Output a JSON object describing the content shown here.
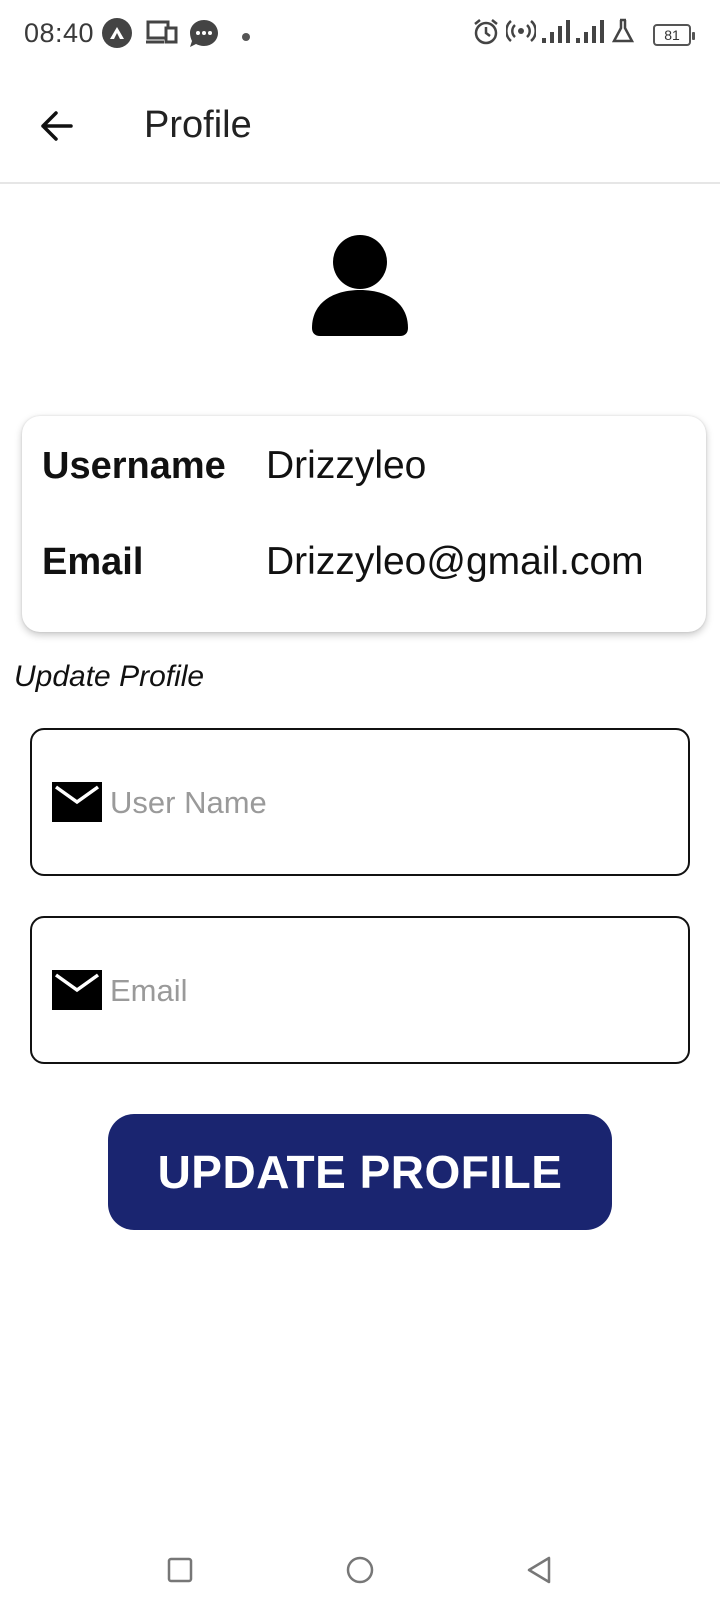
{
  "status_bar": {
    "time": "08:40",
    "battery": "81",
    "icons": [
      "navigation-app-icon",
      "devices-icon",
      "chat-bubble-icon",
      "dot-icon",
      "alarm-icon",
      "hotspot-icon",
      "signal-icon",
      "signal-icon",
      "lab-flask-icon",
      "battery-icon"
    ]
  },
  "app_bar": {
    "title": "Profile",
    "back_icon": "arrow-left-icon"
  },
  "avatar": {
    "icon": "person-icon"
  },
  "info_card": {
    "username_label": "Username",
    "username_value": "Drizzyleo",
    "email_label": "Email",
    "email_value": "Drizzyleo@gmail.com"
  },
  "update_section": {
    "title": "Update Profile",
    "username_input": {
      "placeholder": "User Name",
      "value": "",
      "icon": "mail-icon"
    },
    "email_input": {
      "placeholder": "Email",
      "value": "",
      "icon": "mail-icon"
    },
    "submit_label": "UPDATE PROFILE"
  },
  "nav_bar": {
    "items": [
      "recents-square-icon",
      "home-circle-icon",
      "back-triangle-icon"
    ]
  },
  "colors": {
    "button_bg": "#1a2570",
    "button_text": "#ffffff",
    "placeholder": "#9a9a9a"
  }
}
